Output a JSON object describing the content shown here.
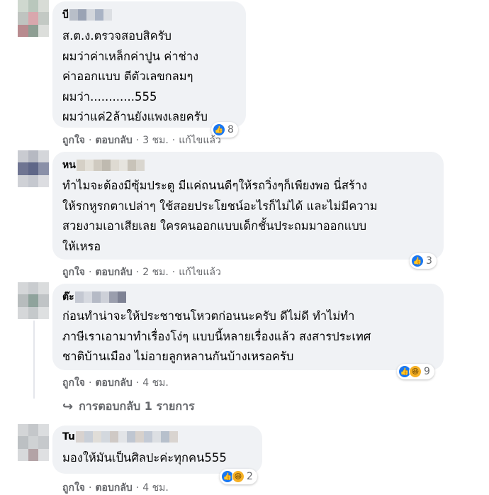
{
  "comments": [
    {
      "author": "บี",
      "lines": [
        "ส.ต.ง.ตรวจสอบสิครับ",
        "ผมว่าค่าเหล็กค่าปูน ค่าช่าง",
        "ค่าออกแบบ ตีตัวเลขกลมๆ",
        "ผมว่า............555",
        "ผมว่าแค่2ล้านยังแพงเลยครับ"
      ],
      "reaction_count": "8",
      "like_label": "ถูกใจ",
      "reply_label": "ตอบกลับ",
      "time": "3 ชม.",
      "edited": "แก้ไขแล้ว"
    },
    {
      "author": "หน",
      "lines": [
        "ทำไมจะต้องมีซุ้มประตู มีแค่ถนนดีๆให้รถวิ่งๆก็เพียงพอ นี่สร้าง",
        "ให้รกหูรกตาเปล่าๆ ใช้สอยประโยชน์อะไรก็ไม่ได้ และไม่มีความ",
        "สวยงามเอาเสียเลย ใครคนออกแบบเด็กชั้นประถมมาออกแบบ",
        "ให้เหรอ"
      ],
      "reaction_count": "3",
      "like_label": "ถูกใจ",
      "reply_label": "ตอบกลับ",
      "time": "2 ชม.",
      "edited": "แก้ไขแล้ว"
    },
    {
      "author": "ต๊ะ",
      "lines": [
        "ก่อนทำน่าจะให้ประชาชนโหวตก่อนนะครับ ดีไม่ดี ทำไม่ทำ",
        "ภาษีเราเอามาทำเรื่องโง่ๆ แบบนี้หลายเรื่องแล้ว สงสารประเทศ",
        "ชาติบ้านเมือง ไม่อายลูกหลานกันบ้างเหรอครับ"
      ],
      "reaction_count": "9",
      "like_label": "ถูกใจ",
      "reply_label": "ตอบกลับ",
      "time": "4 ชม."
    },
    {
      "author": "Tu",
      "lines": [
        "มองให้มันเป็นศิลปะค่ะทุกคน555"
      ],
      "reaction_count": "2",
      "like_label": "ถูกใจ",
      "reply_label": "ตอบกลับ",
      "time": "4 ชม."
    }
  ],
  "replies_link": "การตอบกลับ 1 รายการ",
  "separator": "·",
  "icons": {
    "like": "like-icon",
    "haha": "haha-icon",
    "reply_arrow": "reply-arrow-icon"
  },
  "colors": {
    "bubble": "#f0f2f5",
    "meta_text": "#65676b",
    "like_blue": "#1877f2",
    "haha_yellow": "#f7b125"
  }
}
